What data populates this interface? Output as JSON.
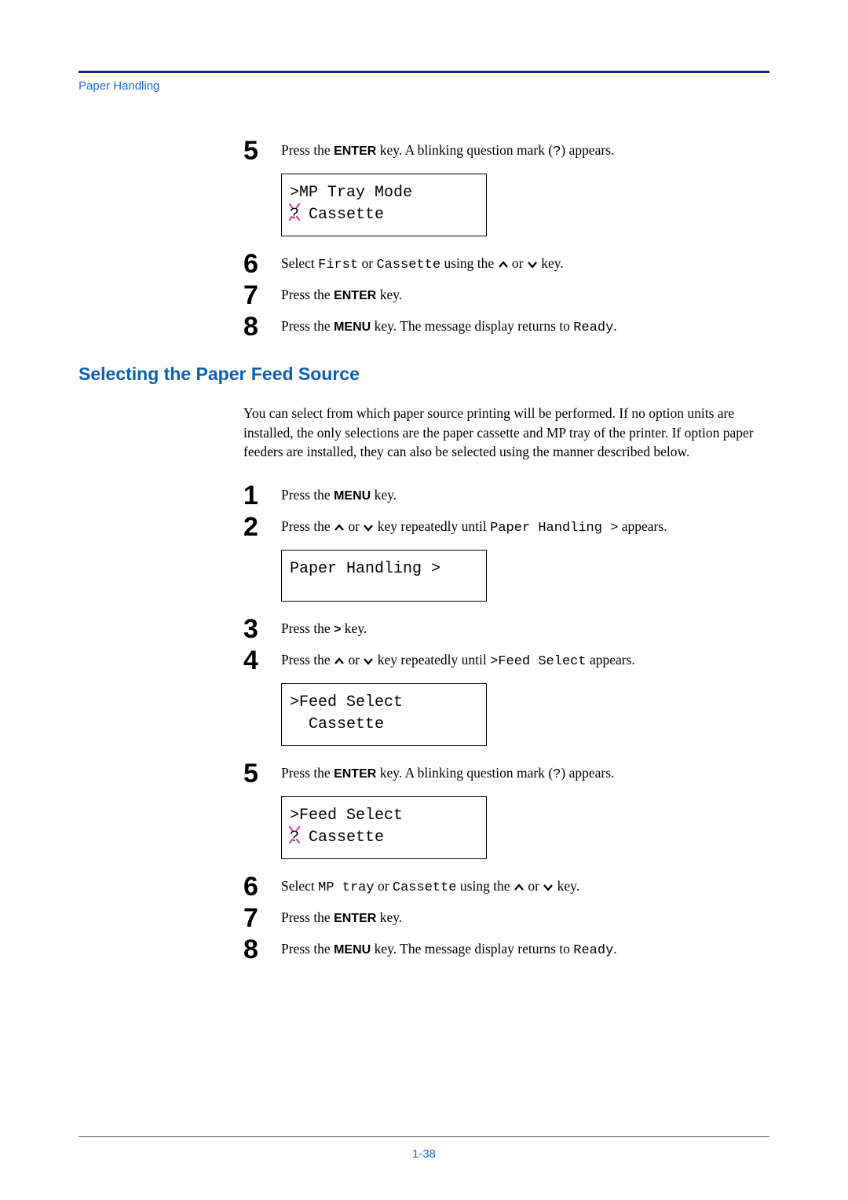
{
  "header": "Paper Handling",
  "page_number": "1-38",
  "section_a": {
    "step5": {
      "num": "5",
      "text_parts": [
        "Press the ",
        "ENTER",
        " key. A blinking question mark (",
        "?",
        ") appears."
      ]
    },
    "lcd5": {
      "line1": ">MP Tray Mode",
      "line2_q": "?",
      "line2_rest": " Cassette"
    },
    "step6": {
      "num": "6",
      "parts": [
        "Select ",
        "First",
        " or ",
        "Cassette",
        " using the ",
        "UP",
        " or ",
        "DOWN",
        " key."
      ]
    },
    "step7": {
      "num": "7",
      "parts": [
        "Press the ",
        "ENTER",
        " key."
      ]
    },
    "step8": {
      "num": "8",
      "parts": [
        "Press the ",
        "MENU",
        " key. The message display returns to ",
        "Ready",
        "."
      ]
    }
  },
  "section_b": {
    "heading": "Selecting the Paper Feed Source",
    "intro": "You can select from which paper source printing will be performed. If no option units are installed, the only selections are the paper cassette and MP tray of the printer. If option paper feeders are installed, they can also be selected using the manner described below.",
    "step1": {
      "num": "1",
      "parts": [
        "Press the ",
        "MENU",
        " key."
      ]
    },
    "step2": {
      "num": "2",
      "parts": [
        "Press the ",
        "UP",
        " or ",
        "DOWN",
        " key repeatedly until ",
        "Paper Handling >",
        " appears."
      ]
    },
    "lcd2": {
      "line1": "Paper Handling >"
    },
    "step3": {
      "num": "3",
      "parts": [
        "Press the ",
        ">",
        " key."
      ]
    },
    "step4": {
      "num": "4",
      "parts": [
        "Press the ",
        "UP",
        " or ",
        "DOWN",
        " key repeatedly until ",
        ">Feed Select",
        " appears."
      ]
    },
    "lcd4": {
      "line1": ">Feed Select",
      "line2": "  Cassette"
    },
    "step5": {
      "num": "5",
      "parts": [
        "Press the ",
        "ENTER",
        " key. A blinking question mark (",
        "?",
        ") appears."
      ]
    },
    "lcd5": {
      "line1": ">Feed Select",
      "line2_q": "?",
      "line2_rest": " Cassette"
    },
    "step6": {
      "num": "6",
      "parts": [
        "Select ",
        "MP tray",
        " or ",
        "Cassette",
        " using the ",
        "UP",
        " or ",
        "DOWN",
        " key."
      ]
    },
    "step7": {
      "num": "7",
      "parts": [
        "Press the ",
        "ENTER",
        " key."
      ]
    },
    "step8": {
      "num": "8",
      "parts": [
        "Press the ",
        "MENU",
        " key. The message display returns to ",
        "Ready",
        "."
      ]
    }
  }
}
